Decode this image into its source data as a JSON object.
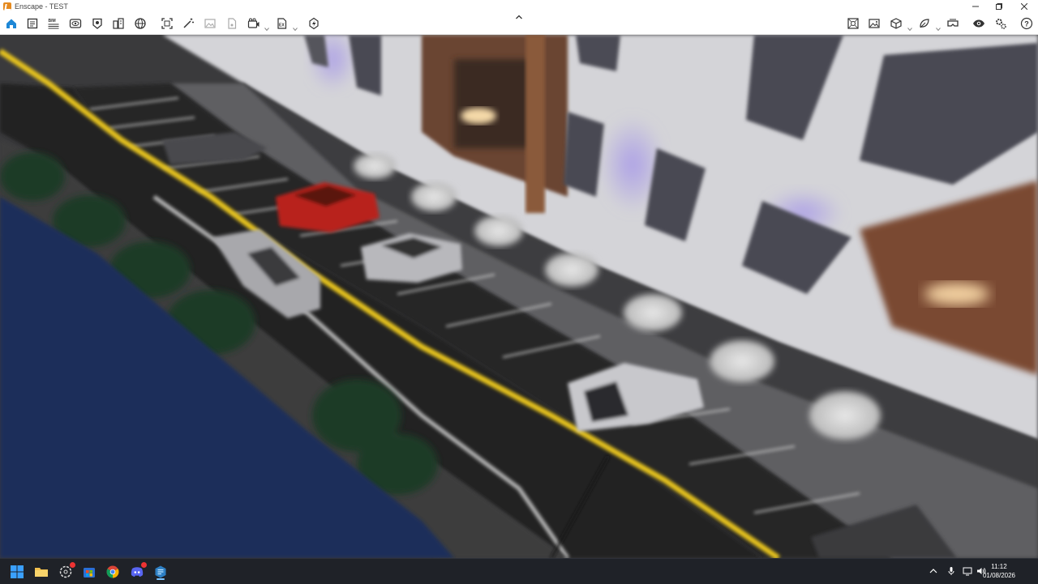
{
  "window": {
    "title": "Enscape - TEST",
    "controls": [
      "minimize-icon",
      "maximize-icon",
      "close-icon"
    ]
  },
  "toolbar": {
    "left_icons": [
      "home-icon",
      "project-icon",
      "bim-icon",
      "eye-mode-icon",
      "render-mode-icon",
      "buildings-icon",
      "sphere-icon",
      "fit-view-icon",
      "magic-icon",
      "image-icon",
      "file-icon",
      "video-camera-icon",
      "export-icon",
      "rocket-icon"
    ],
    "right_icons": [
      "camera-icon",
      "gallery-icon",
      "cube-icon",
      "material-icon",
      "vr-headset-icon",
      "visibility-icon",
      "settings-icon",
      "help-icon"
    ],
    "accent": "#1e87d6"
  },
  "viewport": {
    "scene": "rendered-street-parking-view"
  },
  "taskbar": {
    "apps": [
      "windows-start-icon",
      "file-explorer-icon",
      "chatgpt-icon",
      "store-icon",
      "chrome-icon",
      "discord-icon",
      "enscape-app-icon"
    ],
    "discord_badge": "1",
    "tray_icons": [
      "chevron-up-icon",
      "microphone-icon",
      "monitor-icon",
      "speaker-icon"
    ],
    "time": "11:12",
    "date": "01/08/2026"
  }
}
